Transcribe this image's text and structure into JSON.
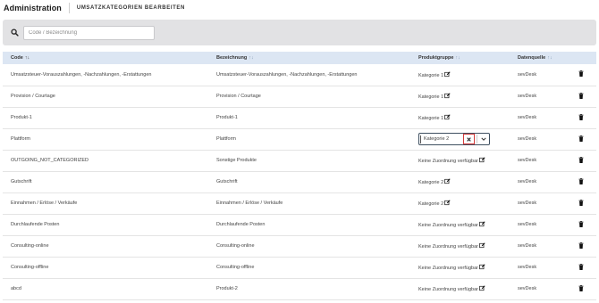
{
  "header": {
    "title": "Administration",
    "subtitle": "UMSATZKATEGORIEN BEARBEITEN"
  },
  "filter": {
    "placeholder": "Code / Bezeichnung",
    "value": ""
  },
  "table": {
    "columns": {
      "code": "Code",
      "code_sort": "↑↓",
      "bezeichnung": "Bezeichnung",
      "bezeichnung_sort": "↑↓",
      "produktgruppe": "Produktgruppe",
      "produktgruppe_sort": "↑↓",
      "datenquelle": "Datenquelle",
      "datenquelle_sort": "↑↓"
    },
    "rows": [
      {
        "code": "Umsatzsteuer-Vorauszahlungen, -Nachzahlungen, -Erstattungen",
        "bezeichnung": "Umsatzsteuer-Vorauszahlungen, -Nachzahlungen, -Erstattungen",
        "produktgruppe": "Kategorie 1",
        "datenquelle": "sevDesk"
      },
      {
        "code": "Provision / Courtage",
        "bezeichnung": "Provision / Courtage",
        "produktgruppe": "Kategorie 1",
        "datenquelle": "sevDesk"
      },
      {
        "code": "Produkt-1",
        "bezeichnung": "Produkt-1",
        "produktgruppe": "Kategorie 1",
        "datenquelle": "sevDesk"
      },
      {
        "code": "Plattform",
        "bezeichnung": "Plattform",
        "produktgruppe": "Kategorie 2",
        "datenquelle": "sevDesk",
        "editing": true
      },
      {
        "code": "OUTGOING_NOT_CATEGORIZED",
        "bezeichnung": "Sonstige Produkte",
        "produktgruppe": "Keine Zuordnung verfügbar",
        "datenquelle": "sevDesk"
      },
      {
        "code": "Gutschrift",
        "bezeichnung": "Gutschrift",
        "produktgruppe": "Kategorie 2",
        "datenquelle": "sevDesk"
      },
      {
        "code": "Einnahmen / Erlöse / Verkäufe",
        "bezeichnung": "Einnahmen / Erlöse / Verkäufe",
        "produktgruppe": "Kategorie 2",
        "datenquelle": "sevDesk"
      },
      {
        "code": "Durchlaufende Posten",
        "bezeichnung": "Durchlaufende Posten",
        "produktgruppe": "Keine Zuordnung verfügbar",
        "datenquelle": "sevDesk"
      },
      {
        "code": "Consulting-online",
        "bezeichnung": "Consulting-online",
        "produktgruppe": "Keine Zuordnung verfügbar",
        "datenquelle": "sevDesk"
      },
      {
        "code": "Consulting-offline",
        "bezeichnung": "Consulting-offline",
        "produktgruppe": "Keine Zuordnung verfügbar",
        "datenquelle": "sevDesk"
      },
      {
        "code": "abcd",
        "bezeichnung": "Produkt-2",
        "produktgruppe": "Keine Zuordnung verfügbar",
        "datenquelle": "sevDesk"
      }
    ]
  },
  "icons": {
    "search": "search-icon",
    "edit": "edit-icon",
    "delete": "trash-icon",
    "clear": "close-icon",
    "dropdown": "chevron-down-icon"
  },
  "colors": {
    "header_row": "#dce6f3",
    "filter_panel": "#e2e2e4",
    "clear_highlight": "#d23a3a"
  }
}
